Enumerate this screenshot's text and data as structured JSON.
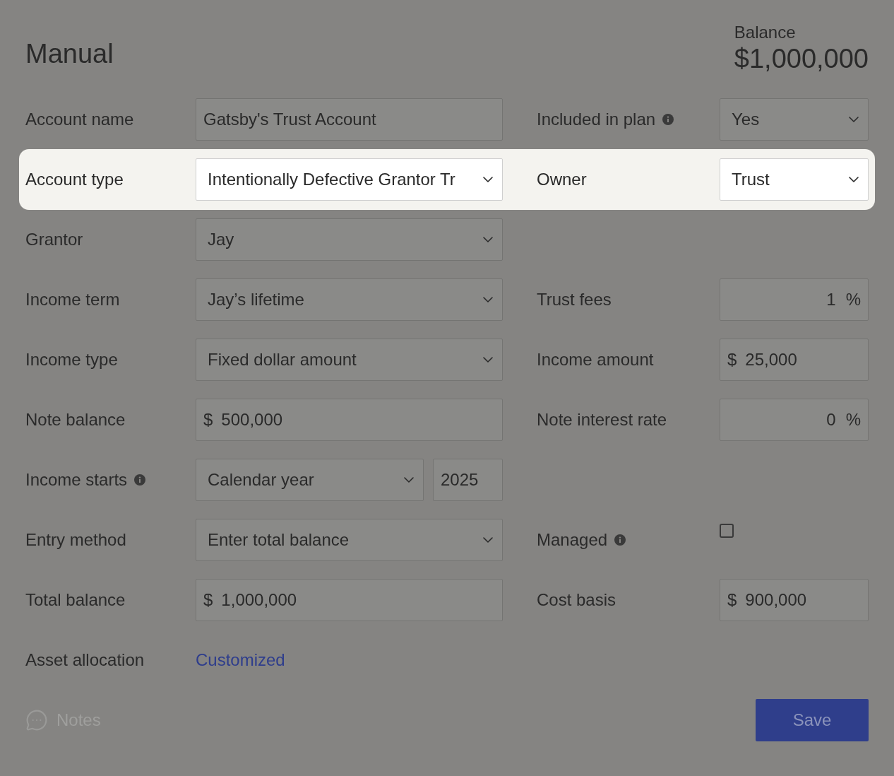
{
  "header": {
    "title": "Manual",
    "balance_label": "Balance",
    "balance_value": "$1,000,000"
  },
  "rows": [
    {
      "highlighted": false,
      "fields": [
        {
          "label": "Account name",
          "kind": "text",
          "value": "Gatsby's Trust Account"
        },
        {
          "label": "Included in plan",
          "info": true,
          "kind": "select",
          "value": "Yes"
        }
      ]
    },
    {
      "highlighted": true,
      "fields": [
        {
          "label": "Account type",
          "kind": "select",
          "value": "Intentionally Defective Grantor Tr"
        },
        {
          "label": "Owner",
          "kind": "select",
          "value": "Trust"
        }
      ]
    },
    {
      "highlighted": false,
      "fields": [
        {
          "label": "Grantor",
          "kind": "select",
          "value": "Jay"
        }
      ]
    },
    {
      "highlighted": false,
      "fields": [
        {
          "label": "Income term",
          "kind": "select",
          "value": "Jay’s lifetime"
        },
        {
          "label": "Trust fees",
          "kind": "percent",
          "value": "1",
          "suffix": "%"
        }
      ]
    },
    {
      "highlighted": false,
      "fields": [
        {
          "label": "Income type",
          "kind": "select",
          "value": "Fixed dollar amount"
        },
        {
          "label": "Income amount",
          "kind": "currency",
          "prefix": "$",
          "value": "25,000"
        }
      ]
    },
    {
      "highlighted": false,
      "fields": [
        {
          "label": "Note balance",
          "kind": "currency",
          "prefix": "$",
          "value": "500,000"
        },
        {
          "label": "Note interest rate",
          "kind": "percent",
          "value": "0",
          "suffix": "%"
        }
      ]
    },
    {
      "highlighted": false,
      "fields": [
        {
          "label": "Income starts",
          "info": true,
          "kind": "select_year",
          "value": "Calendar year",
          "year": "2025"
        }
      ]
    },
    {
      "highlighted": false,
      "fields": [
        {
          "label": "Entry method",
          "kind": "select",
          "value": "Enter total balance"
        },
        {
          "label": "Managed",
          "info": true,
          "kind": "checkbox",
          "checked": false
        }
      ]
    },
    {
      "highlighted": false,
      "fields": [
        {
          "label": "Total balance",
          "kind": "currency",
          "prefix": "$",
          "value": "1,000,000"
        },
        {
          "label": "Cost basis",
          "kind": "currency",
          "prefix": "$",
          "value": "900,000"
        }
      ]
    },
    {
      "highlighted": false,
      "fields": [
        {
          "label": "Asset allocation",
          "kind": "link",
          "value": "Customized"
        }
      ]
    }
  ],
  "footer": {
    "notes": "Notes",
    "save": "Save"
  }
}
